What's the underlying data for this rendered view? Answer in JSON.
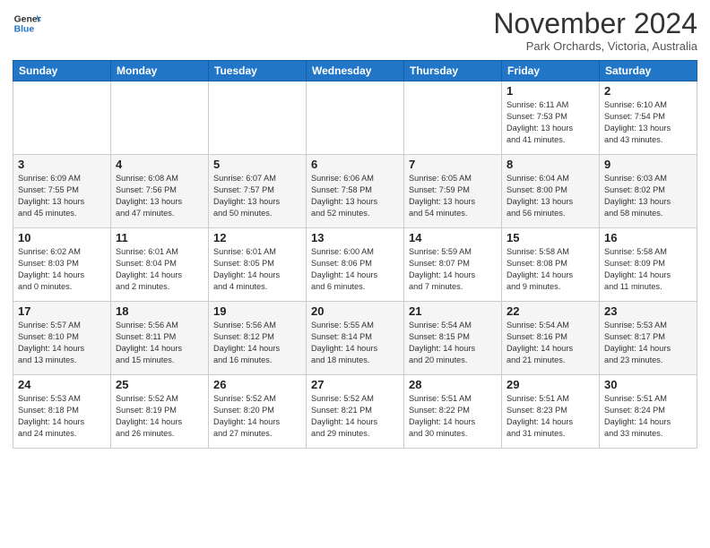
{
  "header": {
    "logo": {
      "general": "General",
      "blue": "Blue"
    },
    "title": "November 2024",
    "location": "Park Orchards, Victoria, Australia"
  },
  "weekdays": [
    "Sunday",
    "Monday",
    "Tuesday",
    "Wednesday",
    "Thursday",
    "Friday",
    "Saturday"
  ],
  "weeks": [
    [
      {
        "day": "",
        "info": ""
      },
      {
        "day": "",
        "info": ""
      },
      {
        "day": "",
        "info": ""
      },
      {
        "day": "",
        "info": ""
      },
      {
        "day": "",
        "info": ""
      },
      {
        "day": "1",
        "info": "Sunrise: 6:11 AM\nSunset: 7:53 PM\nDaylight: 13 hours\nand 41 minutes."
      },
      {
        "day": "2",
        "info": "Sunrise: 6:10 AM\nSunset: 7:54 PM\nDaylight: 13 hours\nand 43 minutes."
      }
    ],
    [
      {
        "day": "3",
        "info": "Sunrise: 6:09 AM\nSunset: 7:55 PM\nDaylight: 13 hours\nand 45 minutes."
      },
      {
        "day": "4",
        "info": "Sunrise: 6:08 AM\nSunset: 7:56 PM\nDaylight: 13 hours\nand 47 minutes."
      },
      {
        "day": "5",
        "info": "Sunrise: 6:07 AM\nSunset: 7:57 PM\nDaylight: 13 hours\nand 50 minutes."
      },
      {
        "day": "6",
        "info": "Sunrise: 6:06 AM\nSunset: 7:58 PM\nDaylight: 13 hours\nand 52 minutes."
      },
      {
        "day": "7",
        "info": "Sunrise: 6:05 AM\nSunset: 7:59 PM\nDaylight: 13 hours\nand 54 minutes."
      },
      {
        "day": "8",
        "info": "Sunrise: 6:04 AM\nSunset: 8:00 PM\nDaylight: 13 hours\nand 56 minutes."
      },
      {
        "day": "9",
        "info": "Sunrise: 6:03 AM\nSunset: 8:02 PM\nDaylight: 13 hours\nand 58 minutes."
      }
    ],
    [
      {
        "day": "10",
        "info": "Sunrise: 6:02 AM\nSunset: 8:03 PM\nDaylight: 14 hours\nand 0 minutes."
      },
      {
        "day": "11",
        "info": "Sunrise: 6:01 AM\nSunset: 8:04 PM\nDaylight: 14 hours\nand 2 minutes."
      },
      {
        "day": "12",
        "info": "Sunrise: 6:01 AM\nSunset: 8:05 PM\nDaylight: 14 hours\nand 4 minutes."
      },
      {
        "day": "13",
        "info": "Sunrise: 6:00 AM\nSunset: 8:06 PM\nDaylight: 14 hours\nand 6 minutes."
      },
      {
        "day": "14",
        "info": "Sunrise: 5:59 AM\nSunset: 8:07 PM\nDaylight: 14 hours\nand 7 minutes."
      },
      {
        "day": "15",
        "info": "Sunrise: 5:58 AM\nSunset: 8:08 PM\nDaylight: 14 hours\nand 9 minutes."
      },
      {
        "day": "16",
        "info": "Sunrise: 5:58 AM\nSunset: 8:09 PM\nDaylight: 14 hours\nand 11 minutes."
      }
    ],
    [
      {
        "day": "17",
        "info": "Sunrise: 5:57 AM\nSunset: 8:10 PM\nDaylight: 14 hours\nand 13 minutes."
      },
      {
        "day": "18",
        "info": "Sunrise: 5:56 AM\nSunset: 8:11 PM\nDaylight: 14 hours\nand 15 minutes."
      },
      {
        "day": "19",
        "info": "Sunrise: 5:56 AM\nSunset: 8:12 PM\nDaylight: 14 hours\nand 16 minutes."
      },
      {
        "day": "20",
        "info": "Sunrise: 5:55 AM\nSunset: 8:14 PM\nDaylight: 14 hours\nand 18 minutes."
      },
      {
        "day": "21",
        "info": "Sunrise: 5:54 AM\nSunset: 8:15 PM\nDaylight: 14 hours\nand 20 minutes."
      },
      {
        "day": "22",
        "info": "Sunrise: 5:54 AM\nSunset: 8:16 PM\nDaylight: 14 hours\nand 21 minutes."
      },
      {
        "day": "23",
        "info": "Sunrise: 5:53 AM\nSunset: 8:17 PM\nDaylight: 14 hours\nand 23 minutes."
      }
    ],
    [
      {
        "day": "24",
        "info": "Sunrise: 5:53 AM\nSunset: 8:18 PM\nDaylight: 14 hours\nand 24 minutes."
      },
      {
        "day": "25",
        "info": "Sunrise: 5:52 AM\nSunset: 8:19 PM\nDaylight: 14 hours\nand 26 minutes."
      },
      {
        "day": "26",
        "info": "Sunrise: 5:52 AM\nSunset: 8:20 PM\nDaylight: 14 hours\nand 27 minutes."
      },
      {
        "day": "27",
        "info": "Sunrise: 5:52 AM\nSunset: 8:21 PM\nDaylight: 14 hours\nand 29 minutes."
      },
      {
        "day": "28",
        "info": "Sunrise: 5:51 AM\nSunset: 8:22 PM\nDaylight: 14 hours\nand 30 minutes."
      },
      {
        "day": "29",
        "info": "Sunrise: 5:51 AM\nSunset: 8:23 PM\nDaylight: 14 hours\nand 31 minutes."
      },
      {
        "day": "30",
        "info": "Sunrise: 5:51 AM\nSunset: 8:24 PM\nDaylight: 14 hours\nand 33 minutes."
      }
    ]
  ]
}
